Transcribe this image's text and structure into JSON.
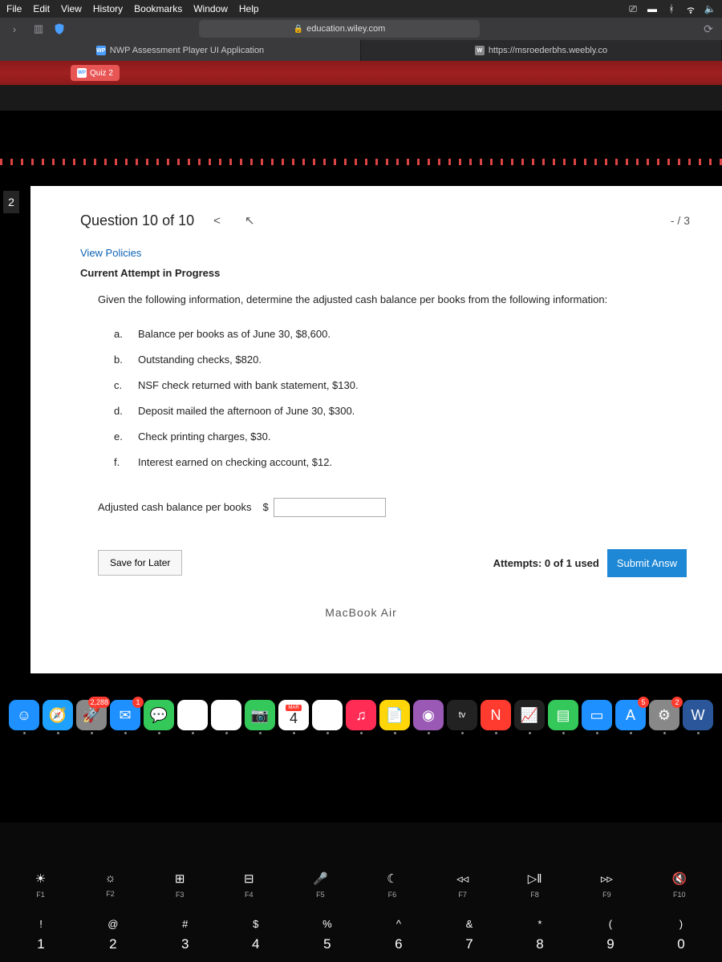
{
  "menubar": {
    "items": [
      "File",
      "Edit",
      "View",
      "History",
      "Bookmarks",
      "Window",
      "Help"
    ]
  },
  "url": "education.wiley.com",
  "tabs": [
    {
      "label": "NWP Assessment Player UI Application",
      "key": "WP"
    },
    {
      "label": "https://msroederbhs.weebly.co",
      "key": "W"
    }
  ],
  "quiz_tab": "Quiz 2",
  "sidebar_num": "2",
  "question": {
    "title": "Question 10 of 10",
    "score": "- / 3",
    "policies": "View Policies",
    "status": "Current Attempt in Progress",
    "prompt": "Given the following information, determine the adjusted cash balance per books from the following information:",
    "items": [
      {
        "l": "a.",
        "t": "Balance per books as of June 30, $8,600."
      },
      {
        "l": "b.",
        "t": "Outstanding checks, $820."
      },
      {
        "l": "c.",
        "t": "NSF check returned with bank statement, $130."
      },
      {
        "l": "d.",
        "t": "Deposit mailed the afternoon of June 30, $300."
      },
      {
        "l": "e.",
        "t": "Check printing charges, $30."
      },
      {
        "l": "f.",
        "t": "Interest earned on checking account, $12."
      }
    ],
    "answer_label": "Adjusted cash balance per books",
    "currency": "$"
  },
  "actions": {
    "save": "Save for Later",
    "attempts": "Attempts: 0 of 1 used",
    "submit": "Submit Answ"
  },
  "dock": {
    "icons": [
      {
        "n": "finder",
        "c": "#1e90ff",
        "g": "☺"
      },
      {
        "n": "safari",
        "c": "#1ea0ff",
        "g": "🧭"
      },
      {
        "n": "launchpad",
        "c": "#888",
        "g": "🚀",
        "b": "2,288"
      },
      {
        "n": "mail",
        "c": "#1e90ff",
        "g": "✉",
        "b": "1"
      },
      {
        "n": "messages",
        "c": "#34c759",
        "g": "💬"
      },
      {
        "n": "maps",
        "c": "#fff",
        "g": "🗺"
      },
      {
        "n": "photos",
        "c": "#fff",
        "g": "✿"
      },
      {
        "n": "facetime",
        "c": "#34c759",
        "g": "📷"
      },
      {
        "n": "calendar",
        "c": "#fff",
        "g": "4",
        "t": "MAR"
      },
      {
        "n": "reminders",
        "c": "#fff",
        "g": "☰"
      },
      {
        "n": "music",
        "c": "#ff2d55",
        "g": "♫"
      },
      {
        "n": "notes",
        "c": "#ffd60a",
        "g": "📄"
      },
      {
        "n": "podcasts",
        "c": "#9b59b6",
        "g": "◉"
      },
      {
        "n": "tv",
        "c": "#222",
        "g": "tv"
      },
      {
        "n": "news",
        "c": "#ff3b30",
        "g": "N"
      },
      {
        "n": "stocks",
        "c": "#222",
        "g": "📈"
      },
      {
        "n": "numbers",
        "c": "#34c759",
        "g": "▤"
      },
      {
        "n": "keynote",
        "c": "#1e90ff",
        "g": "▭"
      },
      {
        "n": "appstore",
        "c": "#1e90ff",
        "g": "A",
        "b": "5"
      },
      {
        "n": "settings",
        "c": "#888",
        "g": "⚙",
        "b": "2"
      },
      {
        "n": "word",
        "c": "#2b579a",
        "g": "W"
      }
    ]
  },
  "kb": {
    "label": "MacBook Air",
    "fn": [
      {
        "i": "☀",
        "l": "F1"
      },
      {
        "i": "☼",
        "l": "F2"
      },
      {
        "i": "⊞",
        "l": "F3"
      },
      {
        "i": "⊟",
        "l": "F4"
      },
      {
        "i": "🎤",
        "l": "F5"
      },
      {
        "i": "☾",
        "l": "F6"
      },
      {
        "i": "◃◃",
        "l": "F7"
      },
      {
        "i": "▷‖",
        "l": "F8"
      },
      {
        "i": "▹▹",
        "l": "F9"
      },
      {
        "i": "🔇",
        "l": "F10"
      }
    ],
    "nums": [
      {
        "s": "!",
        "n": "1"
      },
      {
        "s": "@",
        "n": "2"
      },
      {
        "s": "#",
        "n": "3"
      },
      {
        "s": "$",
        "n": "4"
      },
      {
        "s": "%",
        "n": "5"
      },
      {
        "s": "^",
        "n": "6"
      },
      {
        "s": "&",
        "n": "7"
      },
      {
        "s": "*",
        "n": "8"
      },
      {
        "s": "(",
        "n": "9"
      },
      {
        "s": ")",
        "n": "0"
      }
    ]
  }
}
